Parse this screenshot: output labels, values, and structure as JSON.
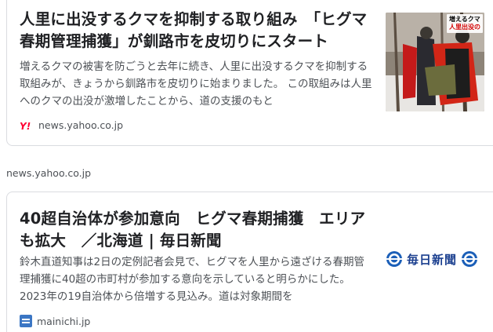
{
  "results": [
    {
      "title": "人里に出没するクマを抑制する取り組み　「ヒグマ春期管理捕獲」が釧路市を皮切りにスタート",
      "snippet": "増えるクマの被害を防ごうと去年に続き、人里に出没するクマを抑制する取組みが、きょうから釧路市を皮切りに始まりました。 この取組みは人里へのクマの出没が激増したことから、道の支援のもと",
      "source": "news.yahoo.co.jp",
      "thumbnail_caption_line1": "増えるクマ",
      "thumbnail_caption_line2": "人里出没の"
    },
    {
      "title": "40超自治体が参加意向　ヒグマ春期捕獲　エリアも拡大　／北海道 | 毎日新聞",
      "snippet": "鈴木直道知事は2日の定例記者会見で、ヒグマを人里から遠ざける春期管理捕獲に40超の市町村が参加する意向を示していると明らかにした。2023年の19自治体から倍増する見込み。道は対象期間を",
      "source": "mainichi.jp",
      "thumbnail_masthead": "毎日新聞"
    }
  ],
  "between_url": "news.yahoo.co.jp",
  "colors": {
    "title": "#202124",
    "snippet": "#4d5156",
    "border": "#dadce0",
    "yahoo_red": "#ff0033",
    "mainichi_blue": "#1b3f8f"
  },
  "icons": {
    "yahoo_favicon": "yahoo-logo-icon",
    "mainichi_favicon": "mainichi-favicon-icon",
    "mainichi_emblem": "mainichi-emblem-icon"
  }
}
